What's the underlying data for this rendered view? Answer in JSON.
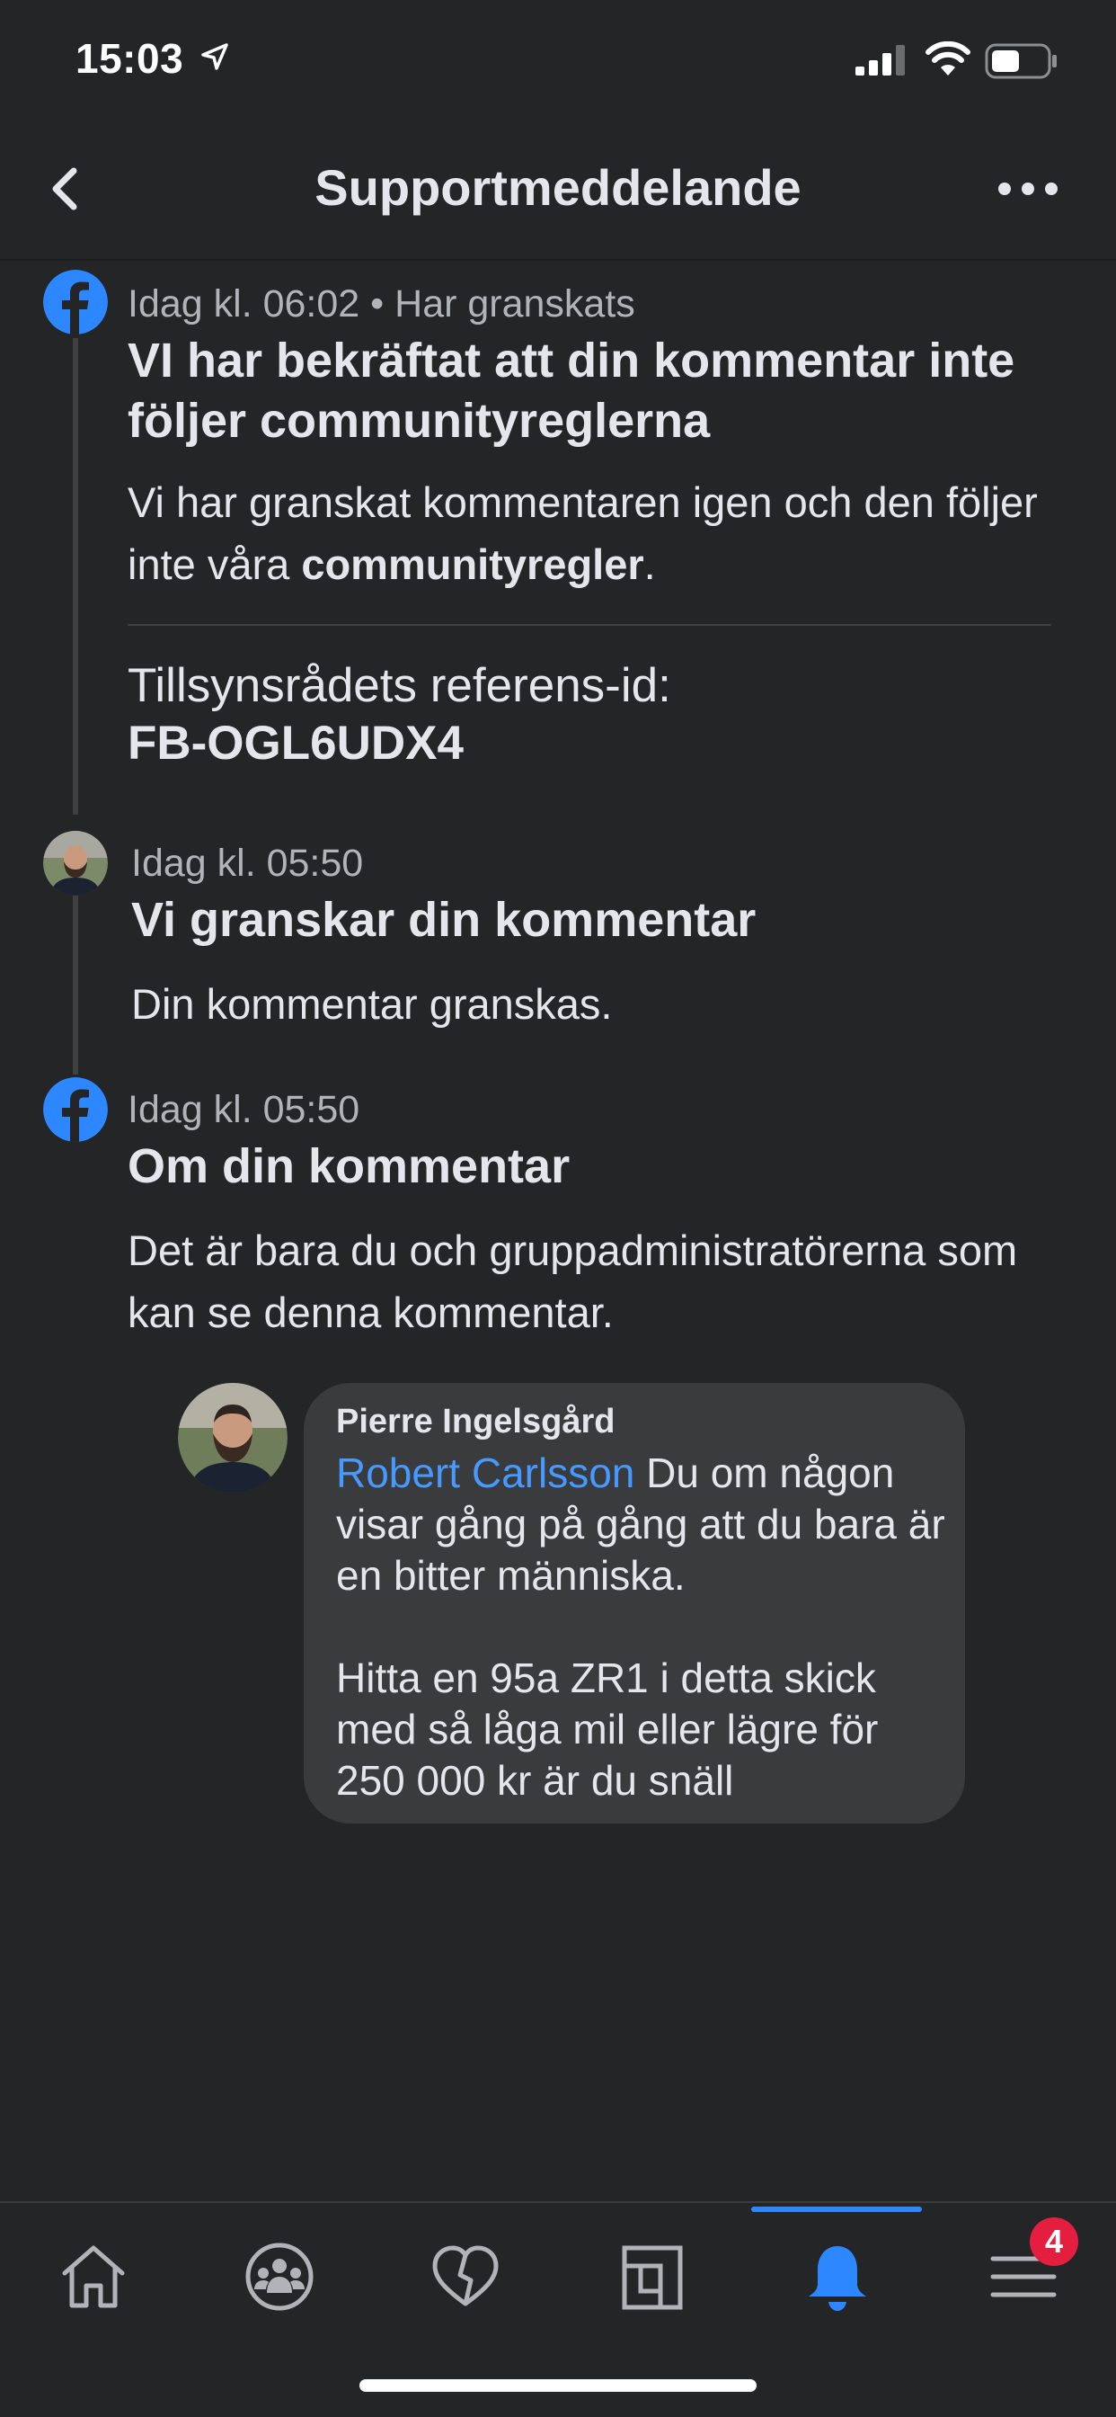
{
  "status_bar": {
    "time": "15:03",
    "icons": [
      "location-arrow-icon",
      "signal-icon",
      "wifi-icon",
      "battery-icon"
    ]
  },
  "header": {
    "title": "Supportmeddelande",
    "back_icon": "chevron-left-icon",
    "more_icon": "more-horizontal-icon"
  },
  "entries": [
    {
      "avatar": "facebook-icon",
      "meta": "Idag kl. 06:02 • Har granskats",
      "title": "VI har bekräftat att din kommentar inte följer communityreglerna",
      "body_prefix": "Vi har granskat kommentaren igen och den följer inte våra ",
      "body_bold": "communityregler",
      "body_suffix": ".",
      "reference_label": "Tillsynsrådets referens-id:",
      "reference_id": "FB-OGL6UDX4"
    },
    {
      "avatar": "user-avatar",
      "meta": "Idag kl. 05:50",
      "title": "Vi granskar din kommentar",
      "body": "Din kommentar granskas."
    },
    {
      "avatar": "facebook-icon",
      "meta": "Idag kl. 05:50",
      "title": "Om din kommentar",
      "body": "Det är bara du och gruppadministratörerna som kan se denna kommentar."
    }
  ],
  "comment": {
    "author": "Pierre Ingelsgård",
    "mention": "Robert Carlsson",
    "text_part1": " Du om någon visar gång på gång att du bara är en bitter människa.",
    "text_part2": "Hitta en 95a ZR1 i detta skick med så låga mil eller lägre för 250 000 kr är du snäll"
  },
  "tab_bar": {
    "tabs": [
      {
        "icon": "home-icon",
        "active": false
      },
      {
        "icon": "groups-icon",
        "active": false
      },
      {
        "icon": "dating-heart-icon",
        "active": false
      },
      {
        "icon": "pages-icon",
        "active": false
      },
      {
        "icon": "bell-icon",
        "active": true
      },
      {
        "icon": "menu-icon",
        "active": false
      }
    ],
    "menu_badge": "4"
  },
  "colors": {
    "background": "#242526",
    "accent": "#2d88ff",
    "mention": "#4599ff",
    "badge": "#e41e3f",
    "bubble": "#3a3b3c"
  }
}
